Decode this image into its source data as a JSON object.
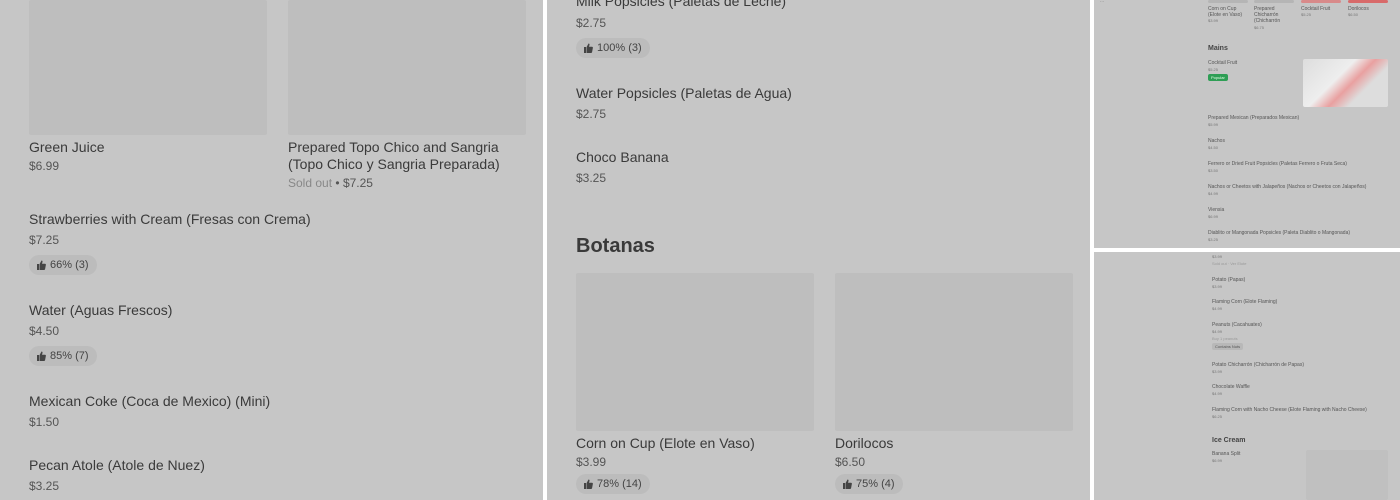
{
  "panel1": {
    "cards": [
      {
        "name": "Green Juice",
        "price": "$6.99"
      },
      {
        "name": "Prepared Topo Chico and Sangria (Topo Chico y Sangria Preparada)",
        "status": "Sold out",
        "price": "$7.25"
      }
    ],
    "list": [
      {
        "name": "Strawberries with Cream (Fresas con Crema)",
        "price": "$7.25",
        "rating": "66% (3)"
      },
      {
        "name": "Water (Aguas Frescos)",
        "price": "$4.50",
        "rating": "85% (7)"
      },
      {
        "name": "Mexican Coke (Coca de Mexico) (Mini)",
        "price": "$1.50"
      },
      {
        "name": "Pecan Atole (Atole de Nuez)",
        "price": "$3.25"
      }
    ]
  },
  "panel2": {
    "list": [
      {
        "name": "Milk Popsicles (Paletas de Leche)",
        "price": "$2.75",
        "rating": "100% (3)"
      },
      {
        "name": "Water Popsicles (Paletas de Agua)",
        "price": "$2.75"
      },
      {
        "name": "Choco Banana",
        "price": "$3.25"
      }
    ],
    "section": "Botanas",
    "cards": [
      {
        "name": "Corn on Cup (Elote en Vaso)",
        "price": "$3.99",
        "rating": "78% (14)"
      },
      {
        "name": "Dorilocos",
        "price": "$6.50",
        "rating": "75% (4)"
      }
    ]
  },
  "panel3": {
    "top_items": [
      {
        "name": "Corn on Cup (Elote en Vaso)",
        "price": "$3.99"
      },
      {
        "name": "Prepared Chicharrón (Chicharrón",
        "price": "$6.75"
      },
      {
        "name": "Cocktail Fruit",
        "price": "$5.25"
      },
      {
        "name": "Dorilocos",
        "price": "$6.50"
      }
    ],
    "section": "Mains",
    "featured": {
      "name": "Cocktail Fruit",
      "price": "$5.25",
      "badge": "Popular"
    },
    "list": [
      {
        "name": "Prepared Mexican (Preparados Mexican)",
        "price": "$5.99"
      },
      {
        "name": "Nachos",
        "price": "$4.50"
      },
      {
        "name": "Ferrero or Dried Fruit Popsicles (Paletas Ferrero o Fruta Seca)",
        "price": "$3.50"
      },
      {
        "name": "Nachos or Cheetos with Jalapeños (Nachos or Cheetos con Jalapeños)",
        "price": "$4.99"
      },
      {
        "name": "Viensia",
        "price": "$6.99"
      },
      {
        "name": "Diablito or Mangonada Popsicles (Paleta Diablito o Mangonada)",
        "price": "$3.25"
      }
    ]
  },
  "panel4": {
    "head_price": "$3.99",
    "head_note": "Sold out · Ver Elote",
    "list": [
      {
        "name": "Potato (Papas)",
        "price": "$3.99"
      },
      {
        "name": "Flaming Corn (Elote Flaming)",
        "price": "$4.99"
      },
      {
        "name": "Peanuts (Cacahuates)",
        "price": "$4.99",
        "note": "Buy 1 peanuts",
        "badge": "Contains Nuts"
      },
      {
        "name": "Potato Chicharrón (Chicharrón de Papas)",
        "price": "$3.99"
      },
      {
        "name": "Chocolate Waffle",
        "price": "$4.99"
      },
      {
        "name": "Flaming Corn with Nacho Cheese (Elote Flaming with Nacho Cheese)",
        "price": "$6.25"
      }
    ],
    "section": "Ice Cream",
    "section_item": {
      "name": "Banana Split",
      "price": "$6.99"
    }
  }
}
